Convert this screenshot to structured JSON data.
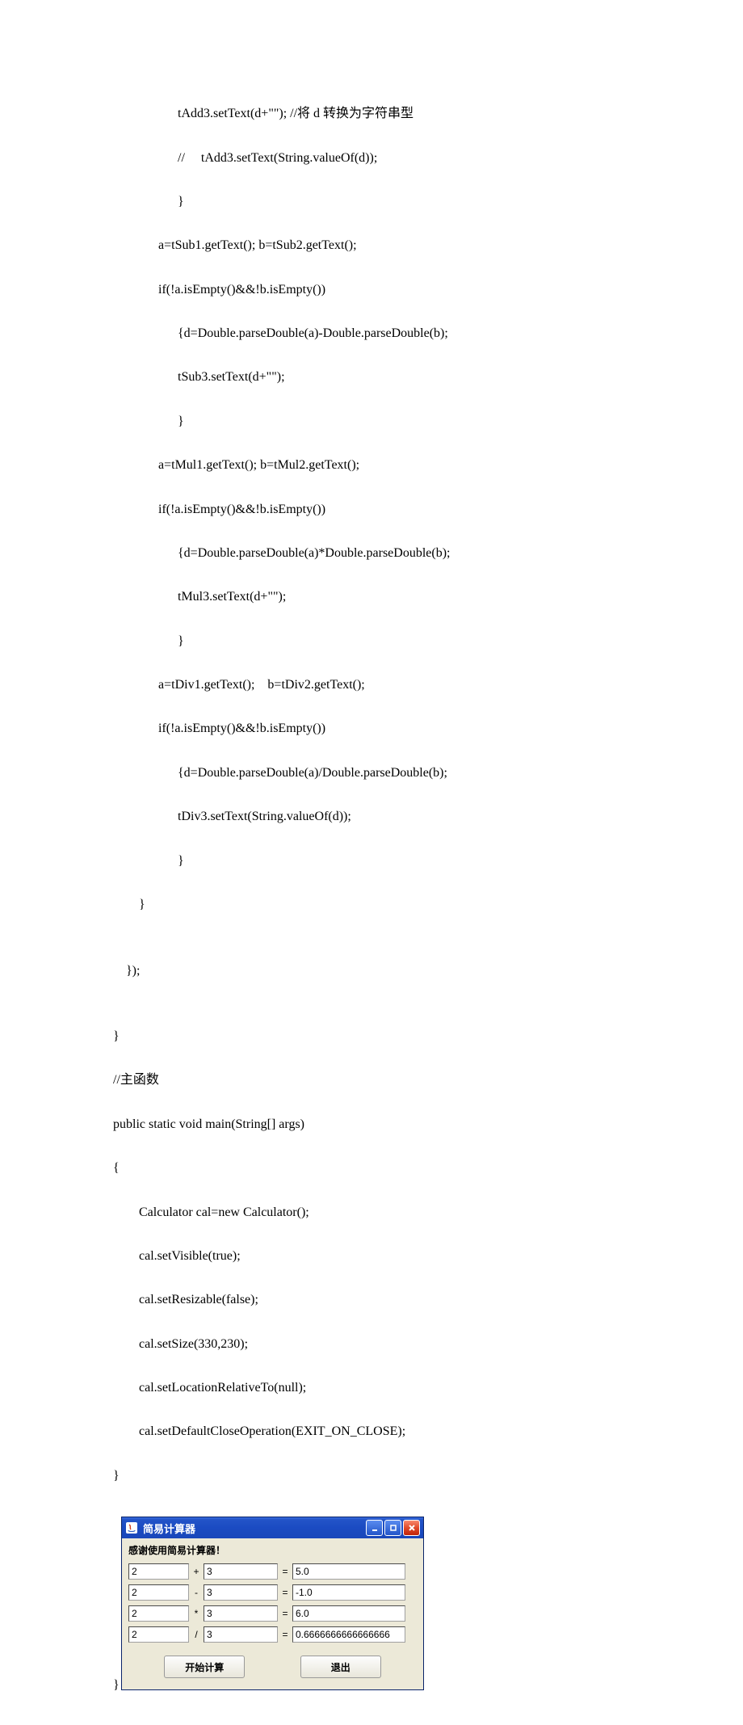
{
  "code": {
    "lines": [
      "                    tAdd3.setText(d+\"\"); //将 d 转换为字符串型",
      "                    //     tAdd3.setText(String.valueOf(d));",
      "                    }",
      "              a=tSub1.getText(); b=tSub2.getText();",
      "              if(!a.isEmpty()&&!b.isEmpty())",
      "                    {d=Double.parseDouble(a)-Double.parseDouble(b);",
      "                    tSub3.setText(d+\"\");",
      "                    }",
      "              a=tMul1.getText(); b=tMul2.getText();",
      "              if(!a.isEmpty()&&!b.isEmpty())",
      "                    {d=Double.parseDouble(a)*Double.parseDouble(b);",
      "                    tMul3.setText(d+\"\");",
      "                    }",
      "              a=tDiv1.getText();    b=tDiv2.getText();",
      "              if(!a.isEmpty()&&!b.isEmpty())",
      "                    {d=Double.parseDouble(a)/Double.parseDouble(b);",
      "                    tDiv3.setText(String.valueOf(d));",
      "                    }",
      "        }",
      "",
      "    });",
      "",
      "}",
      "//主函数",
      "public static void main(String[] args)",
      "{",
      "        Calculator cal=new Calculator();",
      "        cal.setVisible(true);",
      "        cal.setResizable(false);",
      "        cal.setSize(330,230);",
      "        cal.setLocationRelativeTo(null);",
      "        cal.setDefaultCloseOperation(EXIT_ON_CLOSE);",
      "}"
    ]
  },
  "app": {
    "title": "简易计算器",
    "welcome": "感谢使用简易计算器！",
    "rows": [
      {
        "a": "2",
        "op": "+",
        "b": "3",
        "eq": "=",
        "r": "5.0"
      },
      {
        "a": "2",
        "op": "-",
        "b": "3",
        "eq": "=",
        "r": "-1.0"
      },
      {
        "a": "2",
        "op": "*",
        "b": "3",
        "eq": "=",
        "r": "6.0"
      },
      {
        "a": "2",
        "op": "/",
        "b": "3",
        "eq": "=",
        "r": "0.6666666666666666"
      }
    ],
    "buttons": {
      "start": "开始计算",
      "exit": "退出"
    }
  },
  "end_brace": "}"
}
